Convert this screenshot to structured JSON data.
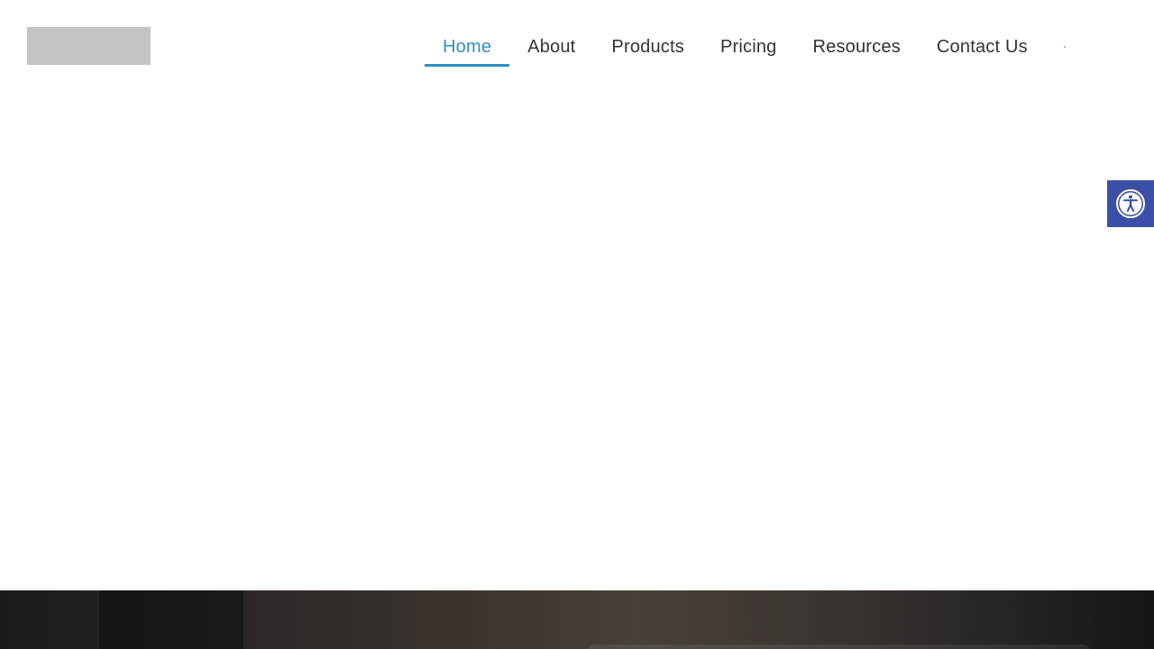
{
  "nav": {
    "items": [
      {
        "label": "Home",
        "active": true
      },
      {
        "label": "About",
        "active": false
      },
      {
        "label": "Products",
        "active": false
      },
      {
        "label": "Pricing",
        "active": false
      },
      {
        "label": "Resources",
        "active": false
      },
      {
        "label": "Contact Us",
        "active": false
      }
    ]
  },
  "colors": {
    "accent": "#2e8fc1",
    "nav_text": "#333333",
    "accessibility_bg": "#3c4fa6"
  },
  "icons": {
    "accessibility": "accessibility-icon"
  }
}
